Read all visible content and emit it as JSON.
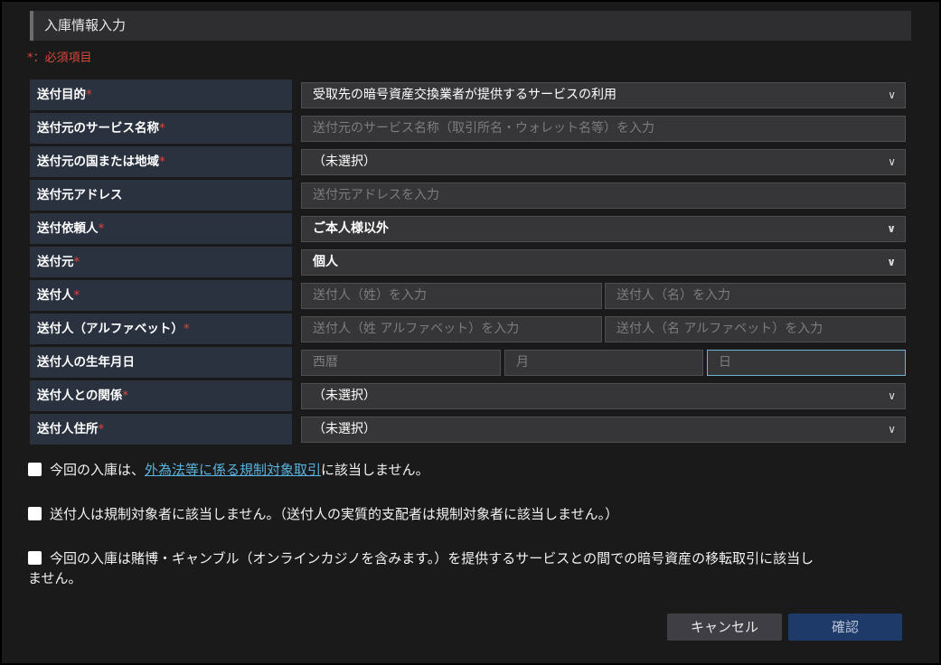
{
  "header": {
    "title": "入庫情報入力"
  },
  "required_note": "*：必須項目",
  "required_mark": "*",
  "rows": [
    {
      "label": "送付目的",
      "required": true,
      "value": "受取先の暗号資産交換業者が提供するサービスの利用"
    },
    {
      "label": "送付元のサービス名称",
      "required": true,
      "placeholder": "送付元のサービス名称（取引所名・ウォレット名等）を入力"
    },
    {
      "label": "送付元の国または地域",
      "required": true,
      "value": "（未選択）"
    },
    {
      "label": "送付元アドレス",
      "required": false,
      "placeholder": "送付元アドレスを入力"
    },
    {
      "label": "送付依頼人",
      "required": true,
      "value": "ご本人様以外"
    },
    {
      "label": "送付元",
      "required": true,
      "value": "個人"
    },
    {
      "label": "送付人",
      "required": true,
      "placeholders": [
        "送付人（姓）を入力",
        "送付人（名）を入力"
      ]
    },
    {
      "label": "送付人（アルファベット）",
      "required": true,
      "placeholders": [
        "送付人（姓 アルファベット）を入力",
        "送付人（名 アルファベット）を入力"
      ]
    },
    {
      "label": "送付人の生年月日",
      "required": false,
      "placeholders": [
        "西暦",
        "月",
        "日"
      ]
    },
    {
      "label": "送付人との関係",
      "required": true,
      "value": "（未選択）"
    },
    {
      "label": "送付人住所",
      "required": true,
      "value": "（未選択）"
    }
  ],
  "checks": [
    {
      "before": "今回の入庫は、",
      "link": "外為法等に係る規制対象取引",
      "after": "に該当しません。"
    },
    {
      "text": "送付人は規制対象者に該当しません。（送付人の実質的支配者は規制対象者に該当しません。）"
    },
    {
      "line1": "今回の入庫は賭博・ギャンブル（オンラインカジノを含みます。）を提供するサービスとの間での暗号資産の移転取引に該当し",
      "line2": "ません。"
    }
  ],
  "buttons": {
    "cancel": "キャンセル",
    "confirm": "確認"
  },
  "icons": {
    "dropdown": "chevron-down-icon",
    "checkbox": "checkbox-unchecked-icon"
  },
  "colors": {
    "required": "#e0453a",
    "link": "#5ab3de",
    "confirm": "#1e3a68",
    "label_bg": "#2a3240"
  }
}
